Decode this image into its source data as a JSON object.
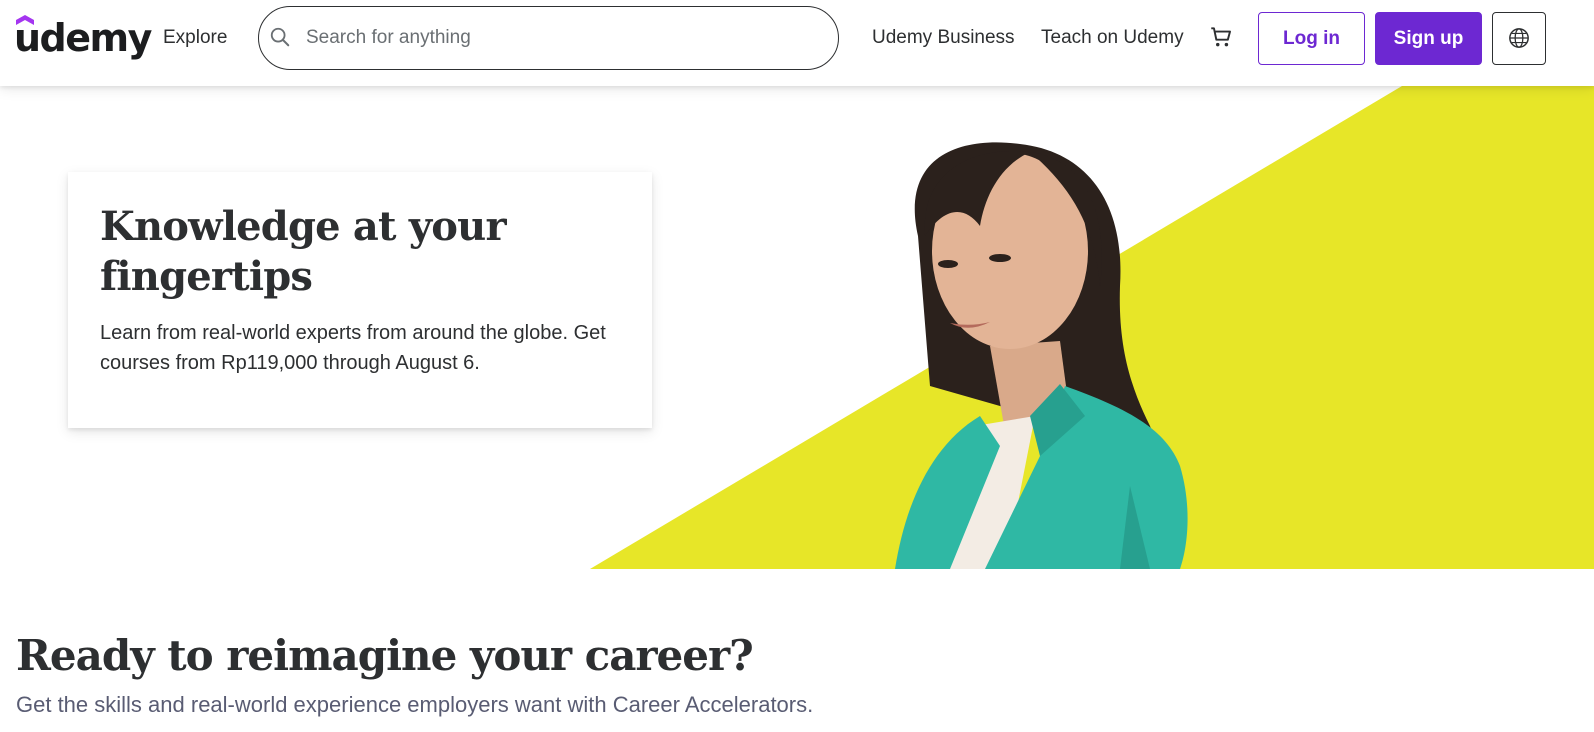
{
  "header": {
    "logo_text": "udemy",
    "explore_label": "Explore",
    "search": {
      "placeholder": "Search for anything",
      "value": ""
    },
    "links": {
      "business": "Udemy Business",
      "teach": "Teach on Udemy"
    },
    "login_label": "Log in",
    "signup_label": "Sign up",
    "icons": {
      "search": "search-icon",
      "cart": "cart-icon",
      "language": "globe-icon"
    }
  },
  "hero": {
    "title": "Knowledge at your fingertips",
    "text": "Learn from real-world experts from around the globe. Get courses from Rp119,000 through August 6."
  },
  "career": {
    "title": "Ready to reimagine your career?",
    "subtitle": "Get the skills and real-world experience employers want with Career Accelerators."
  },
  "colors": {
    "brand_purple": "#6d28d2",
    "hero_yellow": "#e7e628",
    "blazer_teal": "#2fb8a4",
    "text_dark": "#2d2f31",
    "text_muted": "#595c73"
  }
}
